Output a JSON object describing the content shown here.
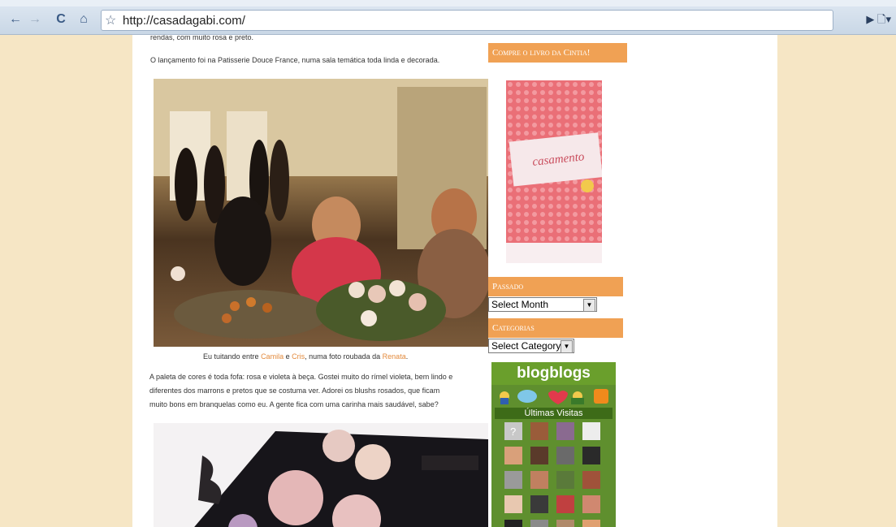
{
  "browser": {
    "url": "http://casadagabi.com/",
    "back_icon": "←",
    "forward_icon": "→",
    "reload_icon": "C",
    "home_icon": "⌂",
    "star_icon": "☆",
    "right_icons": "▶  🗋▾"
  },
  "post": {
    "line1": "rendas, com muito rosa e preto.",
    "line2": "O lançamento foi na Patisserie Douce France, numa sala temática toda linda e decorada.",
    "caption_pre": "Eu tuitando entre ",
    "caption_link1": "Camila",
    "caption_mid1": " e ",
    "caption_link2": "Cris",
    "caption_mid2": ", numa foto roubada da ",
    "caption_link3": "Renata",
    "caption_post": ".",
    "para_line1": "A paleta de cores é toda fofa: rosa e violeta à beça. Gostei muito do rímel violeta, bem lindo e",
    "para_line2": "diferentes dos marrons e pretos que se costuma ver. Adorei os blushs rosados, que ficam",
    "para_line3": "muito bons em branquelas como eu. A gente fica com uma carinha mais saudável, sabe?"
  },
  "sidebar": {
    "book_header": "Compre o livro da Cintia!",
    "book_title": "casamento",
    "passado_header": "Passado",
    "month_select": "Select Month",
    "categorias_header": "Categorias",
    "category_select": "Select Category",
    "blogblogs_logo": "blogblogs",
    "ultimas_visitas": "Últimas Visitas"
  }
}
